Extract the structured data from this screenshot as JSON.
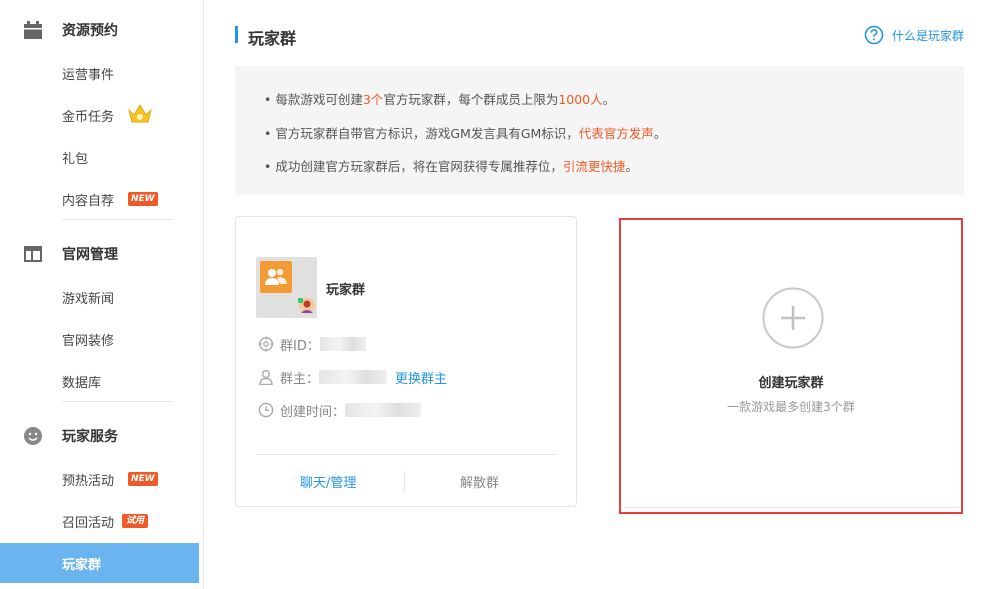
{
  "sidebar": {
    "groups": [
      {
        "label": "资源预约",
        "icon": "calendar-icon",
        "items": [
          {
            "label": "运营事件"
          },
          {
            "label": "金币任务",
            "icon": "crown-icon"
          },
          {
            "label": "礼包"
          },
          {
            "label": "内容自荐",
            "badge": "NEW"
          }
        ]
      },
      {
        "label": "官网管理",
        "icon": "layout-icon",
        "items": [
          {
            "label": "游戏新闻"
          },
          {
            "label": "官网装修"
          },
          {
            "label": "数据库"
          }
        ]
      },
      {
        "label": "玩家服务",
        "icon": "smiley-icon",
        "items": [
          {
            "label": "预热活动",
            "badge": "NEW"
          },
          {
            "label": "召回活动",
            "badge": "试用"
          },
          {
            "label": "玩家群",
            "active": true
          }
        ]
      }
    ]
  },
  "main": {
    "title": "玩家群",
    "help_link": "什么是玩家群",
    "notice": [
      {
        "a": "• 每款游戏可创建",
        "b": "3个",
        "c": "官方玩家群，每个群成员上限为",
        "d": "1000人",
        "e": "。"
      },
      {
        "a": "• 官方玩家群自带官方标识，游戏GM发言具有GM标识，",
        "b": "代表官方发声",
        "c": "。"
      },
      {
        "a": "• 成功创建官方玩家群后，将在官网获得专属推荐位，",
        "b": "引流更快捷",
        "c": "。"
      }
    ],
    "group_card": {
      "name": "玩家群",
      "id_label": "群ID：",
      "owner_label": "群主：",
      "change_owner": "更换群主",
      "created_label": "创建时间：",
      "chat_manage": "聊天/管理",
      "dissolve": "解散群"
    },
    "create_card": {
      "title": "创建玩家群",
      "subtitle": "一款游戏最多创建3个群"
    }
  },
  "colors": {
    "accent": "#2196e3",
    "highlight": "#f05a28",
    "active_nav": "#6ab5ef",
    "create_border": "#e53e3e"
  }
}
